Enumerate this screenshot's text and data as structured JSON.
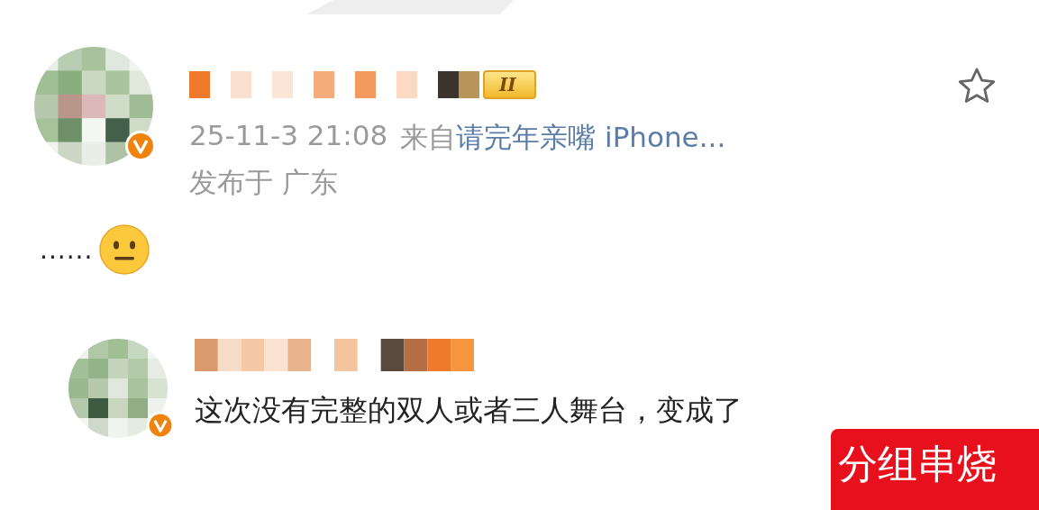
{
  "post": {
    "author_badge": "II",
    "verified": true,
    "time": "25-11-3 21:08",
    "source_prefix": "来自",
    "source": "请完年亲嘴 iPhone...",
    "location": "发布于 广东",
    "content": "......",
    "favorited": false
  },
  "comment": {
    "verified": true,
    "text": "这次没有完整的双人或者三人舞台，变成了",
    "highlight": "分组串烧"
  }
}
